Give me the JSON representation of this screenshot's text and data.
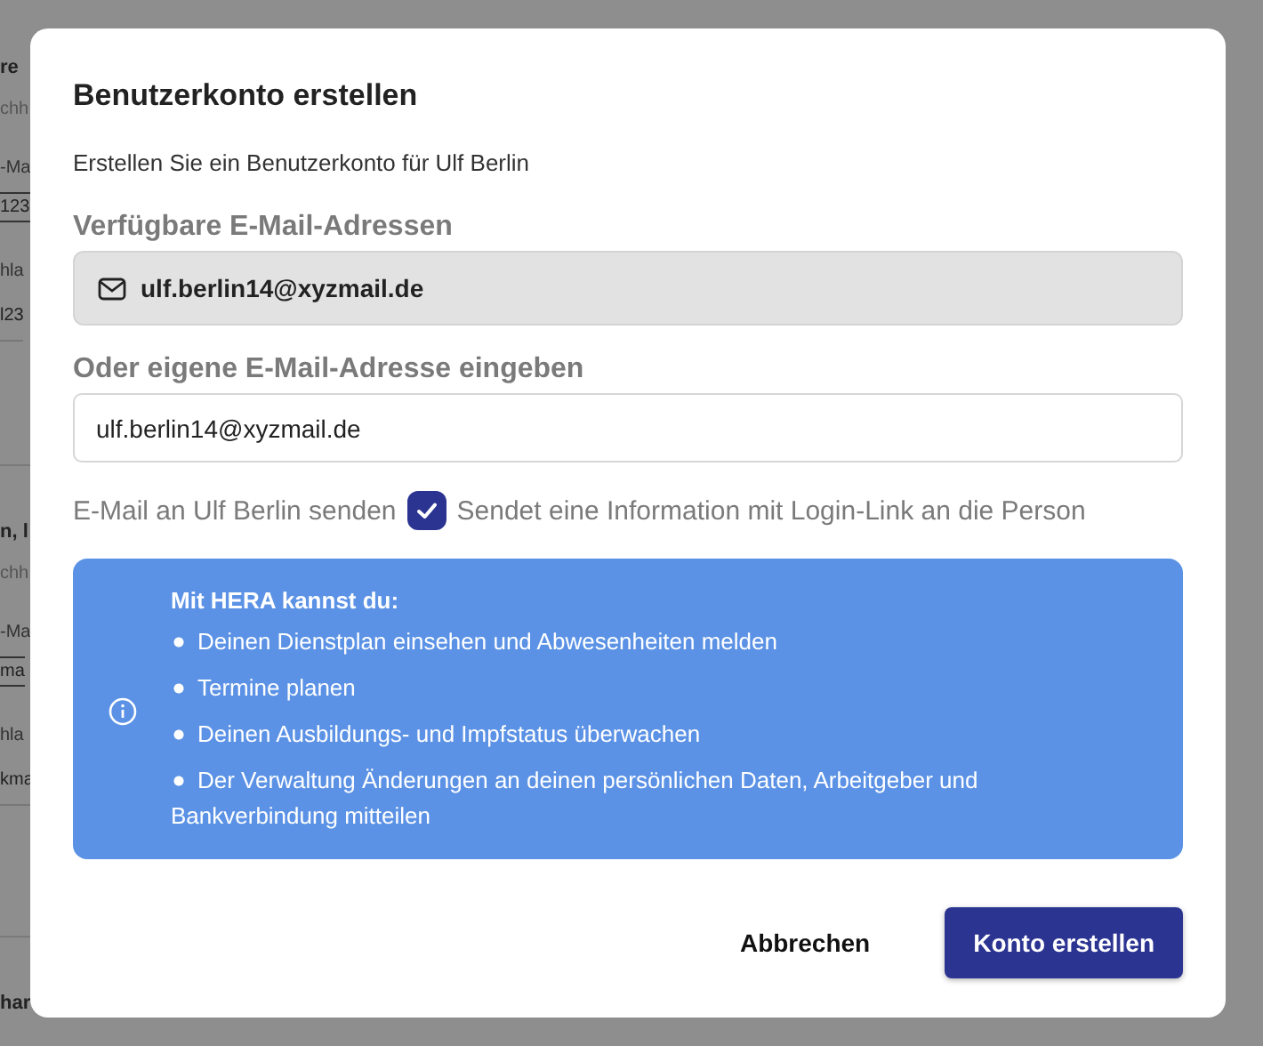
{
  "background": {
    "cards": [
      {
        "title": "re",
        "subtitle": "chh",
        "fields": [
          {
            "label": "-Ma",
            "value": "123",
            "kind": "boxed"
          },
          {
            "label": "hla",
            "value": "l23",
            "kind": "plain"
          }
        ]
      },
      {
        "title": "n, l",
        "subtitle": "chh",
        "fields": [
          {
            "label": "-Ma",
            "value": "ma",
            "kind": "boxed"
          },
          {
            "label": "hla",
            "value": "kma",
            "kind": "plain"
          }
        ]
      },
      {
        "title": "har"
      }
    ]
  },
  "dialog": {
    "title": "Benutzerkonto erstellen",
    "description": "Erstellen Sie ein Benutzerkonto für Ulf Berlin",
    "available_label": "Verfügbare E-Mail-Adressen",
    "available_emails": [
      {
        "address": "ulf.berlin14@xyzmail.de",
        "selected": true
      }
    ],
    "custom_label": "Oder eigene E-Mail-Adresse eingeben",
    "custom_value": "ulf.berlin14@xyzmail.de",
    "send_mail": {
      "label": "E-Mail an Ulf Berlin senden",
      "checked": true,
      "hint": "Sendet eine Information mit Login-Link an die Person"
    },
    "info": {
      "heading": "Mit HERA kannst du:",
      "items": [
        "Deinen Dienstplan einsehen und Abwesenheiten melden",
        "Termine planen",
        "Deinen Ausbildungs- und Impfstatus überwachen",
        "Der Verwaltung Änderungen an deinen persönlichen Daten, Arbeitgeber und Bankverbindung mitteilen"
      ]
    },
    "buttons": [
      {
        "label": "Abbrechen",
        "kind": "secondary"
      },
      {
        "label": "Konto erstellen",
        "kind": "primary"
      }
    ]
  }
}
